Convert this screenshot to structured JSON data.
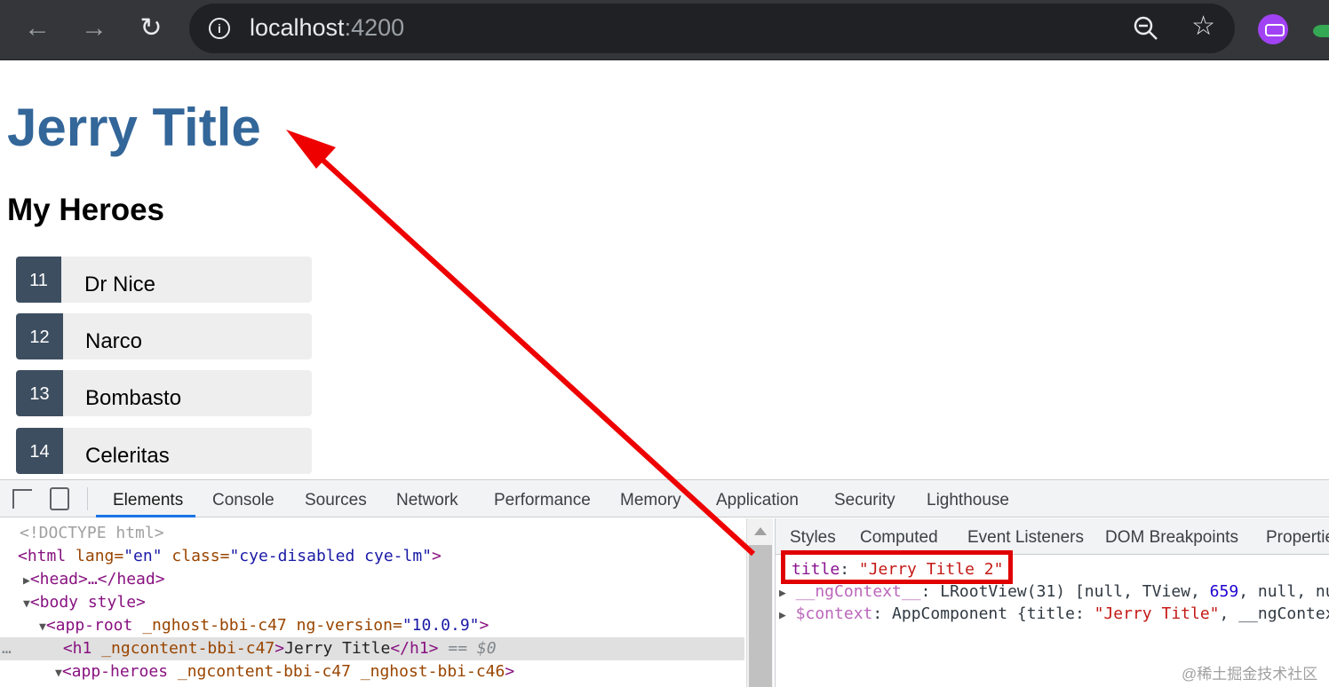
{
  "browser": {
    "url_host": "localhost",
    "url_port": ":4200"
  },
  "page": {
    "title": "Jerry Title",
    "heroes_heading": "My Heroes",
    "heroes": [
      {
        "id": "11",
        "name": "Dr Nice"
      },
      {
        "id": "12",
        "name": "Narco"
      },
      {
        "id": "13",
        "name": "Bombasto"
      },
      {
        "id": "14",
        "name": "Celeritas"
      }
    ]
  },
  "devtools": {
    "tabs": [
      "Elements",
      "Console",
      "Sources",
      "Network",
      "Performance",
      "Memory",
      "Application",
      "Security",
      "Lighthouse"
    ],
    "active_tab": "Elements",
    "side_tabs": [
      "Styles",
      "Computed",
      "Event Listeners",
      "DOM Breakpoints",
      "Properties"
    ],
    "dom": {
      "doctype": "<!DOCTYPE html>",
      "html_open": "<html",
      "html_lang_attr": " lang=",
      "html_lang_val": "\"en\"",
      "html_class_attr": " class=",
      "html_class_val": "\"cye-disabled cye-lm\"",
      "html_close": ">",
      "head": "<head>…</head>",
      "body": "<body style>",
      "app_root_open": "<app-root",
      "app_root_attr1": " _nghost-bbi-c47",
      "app_root_attr2": " ng-version=",
      "app_root_val": "\"10.0.9\"",
      "app_root_close": ">",
      "h1_open": "<h1",
      "h1_attr": " _ngcontent-bbi-c47",
      "h1_gt": ">",
      "h1_text": "Jerry Title",
      "h1_close": "</h1>",
      "h1_eq": " == $0",
      "app_heroes_open": "<app-heroes",
      "app_heroes_attr": " _ngcontent-bbi-c47 _nghost-bbi-c46",
      "app_heroes_close": ">",
      "ellipsis": "…"
    },
    "properties": {
      "title_key": "title",
      "title_sep": ": ",
      "title_val": "\"Jerry Title 2\"",
      "ngcontext_key": "__ngContext__",
      "ngcontext_sep": ": LRootView(31) [null, TView, ",
      "ngcontext_num": "659",
      "ngcontext_rest": ", null, null",
      "context_key": "$context",
      "context_sep": ": AppComponent {title: ",
      "context_val": "\"Jerry Title\"",
      "context_rest": ", __ngContext_"
    }
  },
  "watermark": "@稀土掘金技术社区",
  "colors": {
    "title": "#336699",
    "hero_badge": "#3d4e60",
    "highlight": "#e00000",
    "accent": "#1a73e8"
  }
}
